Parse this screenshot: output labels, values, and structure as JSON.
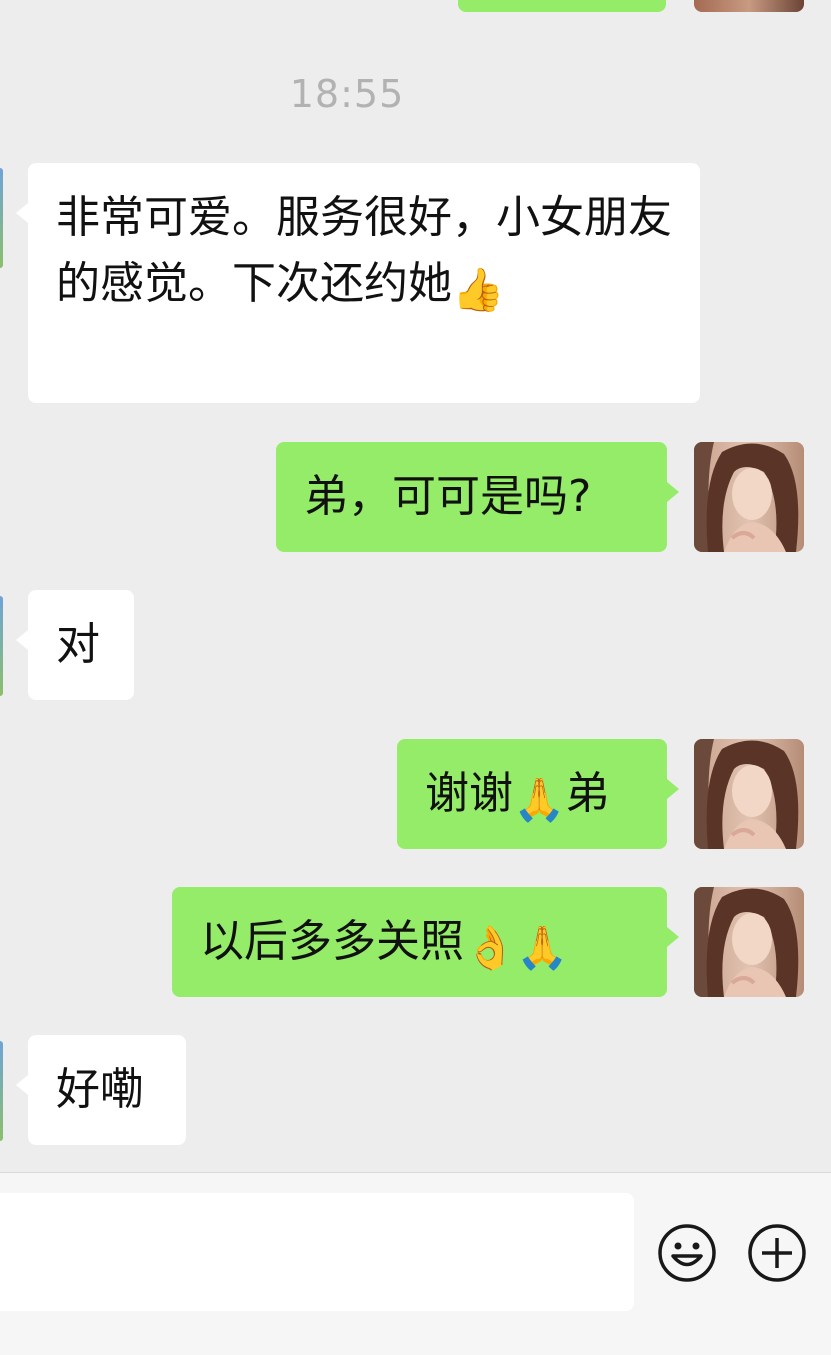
{
  "conversation": {
    "timestamp": "18:55",
    "messages": [
      {
        "side": "in",
        "text": "非常可爱。服务很好，小女朋友的感觉。下次还约她",
        "emoji": "👍"
      },
      {
        "side": "out",
        "text": "弟，可可是吗?"
      },
      {
        "side": "in",
        "text": "对"
      },
      {
        "side": "out",
        "text": "谢谢",
        "emoji": "🙏",
        "text_after": "弟"
      },
      {
        "side": "out",
        "text": "以后多多关照",
        "emoji": "👌🙏"
      },
      {
        "side": "in",
        "text": "好嘞"
      }
    ]
  },
  "input_bar": {
    "value": "",
    "emoji_icon": "smiley-face-icon",
    "more_icon": "plus-circle-icon"
  },
  "colors": {
    "background": "#ededed",
    "outgoing_bubble": "#95ec69",
    "incoming_bubble": "#ffffff",
    "timestamp": "#b2b2b2"
  }
}
